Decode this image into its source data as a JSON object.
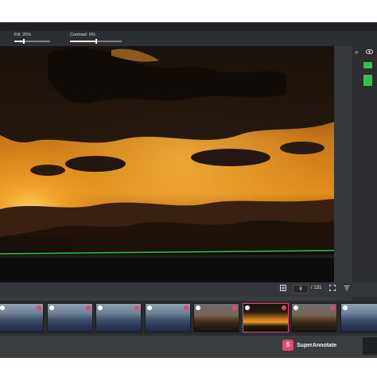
{
  "toolbar": {
    "fill_label": "Fill: 25%",
    "fill_value": 0.25,
    "contrast_label": "Contrast: 0%",
    "contrast_value": 0.0
  },
  "right_panel": {
    "collapse_icon": "chevrons-right-icon",
    "visibility_icon": "eye-icon"
  },
  "frame_nav": {
    "current_frame": "8",
    "total_label": "/ 131"
  },
  "brand": {
    "name": "SuperAnnotate",
    "logo_glyph": "S",
    "color": "#e8476d"
  },
  "colors": {
    "annotation_line": "#33c14a",
    "active_thumb_border": "#e8476d"
  },
  "thumbnails": [
    {
      "style": "blue"
    },
    {
      "style": "blue"
    },
    {
      "style": "blue"
    },
    {
      "style": "blue"
    },
    {
      "style": "dusk"
    },
    {
      "style": "sunset"
    },
    {
      "style": "dusk"
    },
    {
      "style": "blue"
    }
  ],
  "active_thumbnail_index": 5
}
